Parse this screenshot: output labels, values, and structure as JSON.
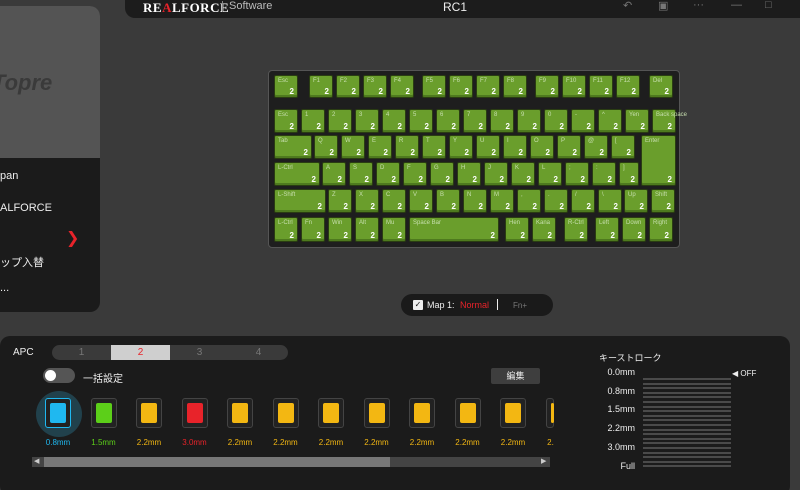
{
  "titlebar": {
    "brand_pre": "RE",
    "brand_x": "A",
    "brand_post": "LFORCE",
    "software": "Software",
    "device": "RC1",
    "icons": [
      "undo-icon",
      "save-icon",
      "more-icon",
      "minimize-icon",
      "maximize-icon"
    ]
  },
  "sidebar": {
    "logo": "Topre",
    "items": [
      {
        "label": "pan"
      },
      {
        "label": "ALFORCE"
      },
      {
        "label": "ップ入替"
      },
      {
        "label": "..."
      }
    ]
  },
  "keyboard": {
    "rows": [
      [
        {
          "l": "Esc",
          "v": "2"
        },
        {
          "l": "F1",
          "v": "2"
        },
        {
          "l": "F2",
          "v": "2"
        },
        {
          "l": "F3",
          "v": "2"
        },
        {
          "l": "F4",
          "v": "2"
        },
        {
          "l": "F5",
          "v": "2"
        },
        {
          "l": "F6",
          "v": "2"
        },
        {
          "l": "F7",
          "v": "2"
        },
        {
          "l": "F8",
          "v": "2"
        },
        {
          "l": "F9",
          "v": "2"
        },
        {
          "l": "F10",
          "v": "2"
        },
        {
          "l": "F11",
          "v": "2"
        },
        {
          "l": "F12",
          "v": "2"
        },
        {
          "l": "Del",
          "v": "2"
        }
      ],
      [
        {
          "l": "Esc",
          "v": "2"
        },
        {
          "l": "1",
          "v": "2"
        },
        {
          "l": "2",
          "v": "2"
        },
        {
          "l": "3",
          "v": "2"
        },
        {
          "l": "4",
          "v": "2"
        },
        {
          "l": "5",
          "v": "2"
        },
        {
          "l": "6",
          "v": "2"
        },
        {
          "l": "7",
          "v": "2"
        },
        {
          "l": "8",
          "v": "2"
        },
        {
          "l": "9",
          "v": "2"
        },
        {
          "l": "0",
          "v": "2"
        },
        {
          "l": "-",
          "v": "2"
        },
        {
          "l": "^",
          "v": "2"
        },
        {
          "l": "Yen",
          "v": "2"
        },
        {
          "l": "Back space",
          "v": "2"
        }
      ],
      [
        {
          "l": "Tab",
          "v": "2"
        },
        {
          "l": "Q",
          "v": "2"
        },
        {
          "l": "W",
          "v": "2"
        },
        {
          "l": "E",
          "v": "2"
        },
        {
          "l": "R",
          "v": "2"
        },
        {
          "l": "T",
          "v": "2"
        },
        {
          "l": "Y",
          "v": "2"
        },
        {
          "l": "U",
          "v": "2"
        },
        {
          "l": "I",
          "v": "2"
        },
        {
          "l": "O",
          "v": "2"
        },
        {
          "l": "P",
          "v": "2"
        },
        {
          "l": "@",
          "v": "2"
        },
        {
          "l": "[",
          "v": "2"
        },
        {
          "l": "Enter",
          "v": "2"
        }
      ],
      [
        {
          "l": "L-Ctrl",
          "v": "2"
        },
        {
          "l": "A",
          "v": "2"
        },
        {
          "l": "S",
          "v": "2"
        },
        {
          "l": "D",
          "v": "2"
        },
        {
          "l": "F",
          "v": "2"
        },
        {
          "l": "G",
          "v": "2"
        },
        {
          "l": "H",
          "v": "2"
        },
        {
          "l": "J",
          "v": "2"
        },
        {
          "l": "K",
          "v": "2"
        },
        {
          "l": "L",
          "v": "2"
        },
        {
          "l": ";",
          "v": "2"
        },
        {
          "l": ":",
          "v": "2"
        },
        {
          "l": "]",
          "v": "2"
        }
      ],
      [
        {
          "l": "L-Shift",
          "v": "2"
        },
        {
          "l": "Z",
          "v": "2"
        },
        {
          "l": "X",
          "v": "2"
        },
        {
          "l": "C",
          "v": "2"
        },
        {
          "l": "V",
          "v": "2"
        },
        {
          "l": "B",
          "v": "2"
        },
        {
          "l": "N",
          "v": "2"
        },
        {
          "l": "M",
          "v": "2"
        },
        {
          "l": ",",
          "v": "2"
        },
        {
          "l": ".",
          "v": "2"
        },
        {
          "l": "/",
          "v": "2"
        },
        {
          "l": "\\",
          "v": "2"
        },
        {
          "l": "Up",
          "v": "2"
        },
        {
          "l": "Shift",
          "v": "2"
        }
      ],
      [
        {
          "l": "L-Ctrl",
          "v": "2"
        },
        {
          "l": "Fn",
          "v": "2"
        },
        {
          "l": "Win",
          "v": "2"
        },
        {
          "l": "Alt",
          "v": "2"
        },
        {
          "l": "Mu",
          "v": "2"
        },
        {
          "l": "Space Bar",
          "v": "2"
        },
        {
          "l": "Hen",
          "v": "2"
        },
        {
          "l": "Kana",
          "v": "2"
        },
        {
          "l": "R-Ctrl",
          "v": "2"
        },
        {
          "l": "Left",
          "v": "2"
        },
        {
          "l": "Down",
          "v": "2"
        },
        {
          "l": "Right",
          "v": "2"
        }
      ]
    ]
  },
  "mapbar": {
    "check": "✓",
    "label": "Map 1:",
    "normal": "Normal",
    "fn": "Fn+"
  },
  "apc": {
    "label": "APC",
    "tabs": [
      "1",
      "2",
      "3",
      "4"
    ],
    "active_tab": 1,
    "bulk_label": "一括設定",
    "edit_button": "編集",
    "swatches": [
      {
        "label": "0.8mm",
        "color": "#1fb8f0",
        "label_color": "#1fb8f0"
      },
      {
        "label": "1.5mm",
        "color": "#5ccf19",
        "label_color": "#5ccf19"
      },
      {
        "label": "2.2mm",
        "color": "#f3b712",
        "label_color": "#f3b712"
      },
      {
        "label": "3.0mm",
        "color": "#e8232a",
        "label_color": "#e8232a"
      },
      {
        "label": "2.2mm",
        "color": "#f3b712",
        "label_color": "#f3b712"
      },
      {
        "label": "2.2mm",
        "color": "#f3b712",
        "label_color": "#f3b712"
      },
      {
        "label": "2.2mm",
        "color": "#f3b712",
        "label_color": "#f3b712"
      },
      {
        "label": "2.2mm",
        "color": "#f3b712",
        "label_color": "#f3b712"
      },
      {
        "label": "2.2mm",
        "color": "#f3b712",
        "label_color": "#f3b712"
      },
      {
        "label": "2.2mm",
        "color": "#f3b712",
        "label_color": "#f3b712"
      },
      {
        "label": "2.2mm",
        "color": "#f3b712",
        "label_color": "#f3b712"
      },
      {
        "label": "2.",
        "color": "#f3b712",
        "label_color": "#f3b712"
      }
    ]
  },
  "keystroke": {
    "title": "キーストローク",
    "labels": [
      "0.0mm",
      "0.8mm",
      "1.5mm",
      "2.2mm",
      "3.0mm",
      "Full"
    ],
    "off_marker": "◀",
    "off_label": "OFF"
  }
}
